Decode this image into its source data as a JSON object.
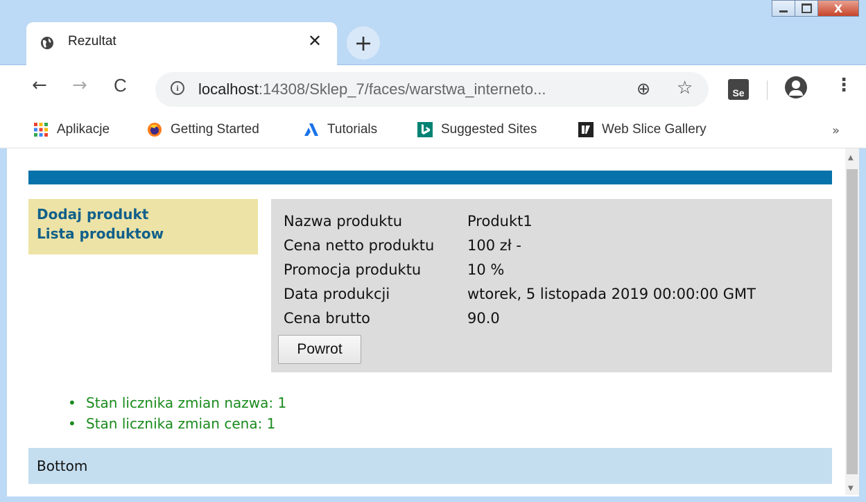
{
  "window": {
    "minimize_glyph": "",
    "maximize_glyph": "",
    "close_glyph": "X"
  },
  "tab": {
    "title": "Rezultat",
    "close_glyph": "✕",
    "new_tab_glyph": "+"
  },
  "toolbar": {
    "back_glyph": "←",
    "forward_glyph": "→",
    "reload_glyph": "C",
    "url_host": "localhost",
    "url_rest": ":14308/Sklep_7/faces/warstwa_interneto...",
    "zoom_glyph": "⊕",
    "star_glyph": "☆",
    "selenium_label": "Se",
    "menu_glyph": "⋮"
  },
  "bookmarks": {
    "items": [
      {
        "label": "Aplikacje",
        "icon": "apps-grid-icon"
      },
      {
        "label": "Getting Started",
        "icon": "firefox-icon"
      },
      {
        "label": "Tutorials",
        "icon": "tutorials-icon"
      },
      {
        "label": "Suggested Sites",
        "icon": "bing-icon"
      },
      {
        "label": "Web Slice Gallery",
        "icon": "web-slice-icon"
      }
    ],
    "more_glyph": "»"
  },
  "page": {
    "menu": {
      "add_product": "Dodaj produkt",
      "product_list": "Lista produktow"
    },
    "details": {
      "rows": [
        {
          "label": "Nazwa produktu",
          "value": "Produkt1"
        },
        {
          "label": "Cena netto produktu",
          "value": "100 zł -"
        },
        {
          "label": "Promocja produktu",
          "value": "10 %"
        },
        {
          "label": "Data produkcji",
          "value": "wtorek, 5 listopada 2019 00:00:00 GMT"
        },
        {
          "label": "Cena brutto",
          "value": "90.0"
        }
      ],
      "back_button": "Powrot"
    },
    "counters": [
      "Stan licznika zmian nazwa: 1",
      "Stan licznika zmian cena: 1"
    ],
    "bottom": "Bottom"
  },
  "colors": {
    "header_bar": "#0672a9",
    "menu_bg": "#ede3a6",
    "menu_link": "#11608a",
    "content_bg": "#dcdcdc",
    "counter_text": "#198a1c",
    "bottom_bg": "#c4def0"
  }
}
